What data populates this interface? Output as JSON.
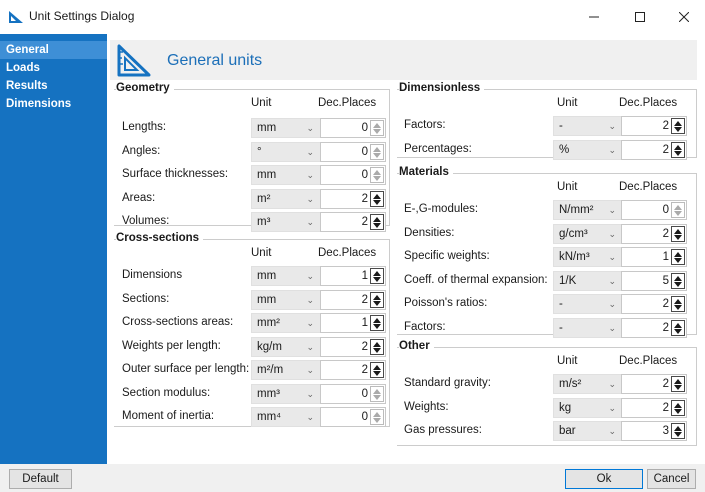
{
  "window": {
    "title": "Unit Settings Dialog",
    "minimize": "—",
    "maximize": "☐",
    "close": "✕"
  },
  "sidebar": {
    "items": [
      {
        "label": "General",
        "active": true
      },
      {
        "label": "Loads"
      },
      {
        "label": "Results"
      },
      {
        "label": "Dimensions"
      }
    ]
  },
  "header": {
    "title": "General units",
    "icon": "set-square-icon"
  },
  "columns": {
    "unit": "Unit",
    "dec": "Dec.Places"
  },
  "groups": {
    "geometry": {
      "title": "Geometry",
      "rows": [
        {
          "label": "Lengths:",
          "unit": "mm",
          "dec": "0"
        },
        {
          "label": "Angles:",
          "unit": "°",
          "dec": "0"
        },
        {
          "label": "Surface thicknesses:",
          "unit": "mm",
          "dec": "0"
        },
        {
          "label": "Areas:",
          "unit": "m²",
          "dec": "2"
        },
        {
          "label": "Volumes:",
          "unit": "m³",
          "dec": "2"
        }
      ]
    },
    "cross": {
      "title": "Cross-sections",
      "rows": [
        {
          "label": "Dimensions",
          "unit": "mm",
          "dec": "1"
        },
        {
          "label": "Sections:",
          "unit": "mm",
          "dec": "2"
        },
        {
          "label": "Cross-sections areas:",
          "unit": "mm²",
          "dec": "1"
        },
        {
          "label": "Weights per length:",
          "unit": "kg/m",
          "dec": "2"
        },
        {
          "label": "Outer surface per length:",
          "unit": "m²/m",
          "dec": "2"
        },
        {
          "label": "Section modulus:",
          "unit": "mm³",
          "dec": "0"
        },
        {
          "label": "Moment of inertia:",
          "unit": "mm⁴",
          "dec": "0"
        }
      ]
    },
    "dimensionless": {
      "title": "Dimensionless",
      "rows": [
        {
          "label": "Factors:",
          "unit": "-",
          "dec": "2"
        },
        {
          "label": "Percentages:",
          "unit": "%",
          "dec": "2"
        }
      ]
    },
    "materials": {
      "title": "Materials",
      "rows": [
        {
          "label": "E-,G-modules:",
          "unit": "N/mm²",
          "dec": "0"
        },
        {
          "label": "Densities:",
          "unit": "g/cm³",
          "dec": "2"
        },
        {
          "label": "Specific weights:",
          "unit": "kN/m³",
          "dec": "1"
        },
        {
          "label": "Coeff. of thermal expansion:",
          "unit": "1/K",
          "dec": "5"
        },
        {
          "label": "Poisson's ratios:",
          "unit": "-",
          "dec": "2"
        },
        {
          "label": "Factors:",
          "unit": "-",
          "dec": "2"
        }
      ]
    },
    "other": {
      "title": "Other",
      "rows": [
        {
          "label": "Standard gravity:",
          "unit": "m/s²",
          "dec": "2"
        },
        {
          "label": "Weights:",
          "unit": "kg",
          "dec": "2"
        },
        {
          "label": "Gas pressures:",
          "unit": "bar",
          "dec": "3"
        }
      ]
    }
  },
  "footer": {
    "default": "Default",
    "ok": "Ok",
    "cancel": "Cancel"
  }
}
